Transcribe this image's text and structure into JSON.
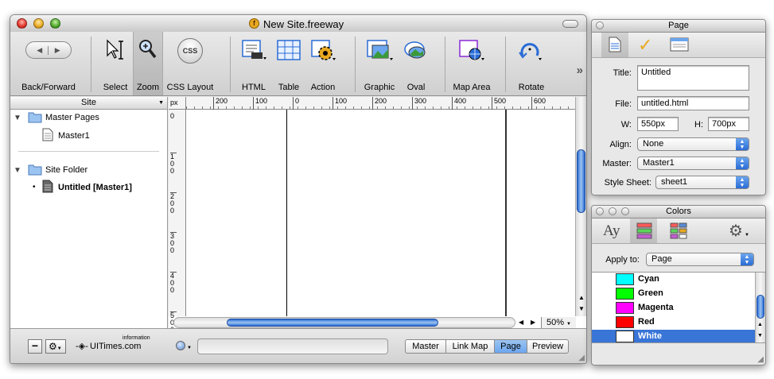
{
  "main_window": {
    "title": "New Site.freeway",
    "toolbar": [
      {
        "label": "Back/Forward"
      },
      {
        "label": "Select"
      },
      {
        "label": "Zoom"
      },
      {
        "label": "CSS Layout"
      },
      {
        "label": "HTML"
      },
      {
        "label": "Table"
      },
      {
        "label": "Action"
      },
      {
        "label": "Graphic"
      },
      {
        "label": "Oval"
      },
      {
        "label": "Map Area"
      },
      {
        "label": "Rotate"
      }
    ],
    "css_icon_text": "CSS",
    "overflow_glyph": "»",
    "site_panel": {
      "header": "Site",
      "tree": [
        {
          "label": "Master Pages",
          "type": "folder"
        },
        {
          "label": "Master1",
          "type": "page"
        },
        {
          "label": "Site Folder",
          "type": "folder"
        },
        {
          "label": "Untitled [Master1]",
          "type": "page",
          "current": true
        }
      ]
    },
    "ruler": {
      "unit": "px",
      "h_ticks": [
        "200",
        "100",
        "0",
        "100",
        "200",
        "300",
        "400",
        "500",
        "600"
      ],
      "v_ticks": [
        "0",
        "100",
        "200",
        "300",
        "400",
        "500"
      ]
    },
    "zoom_level": "50%",
    "status_bar": {
      "brand": "UITimes.com",
      "brand_sup": "information",
      "view_tabs": [
        "Master",
        "Link Map",
        "Page",
        "Preview"
      ],
      "active_tab": "Page"
    }
  },
  "page_palette": {
    "title": "Page",
    "fields": {
      "title_label": "Title:",
      "title_value": "Untitled",
      "file_label": "File:",
      "file_value": "untitled.html",
      "w_label": "W:",
      "w_value": "550px",
      "h_label": "H:",
      "h_value": "700px",
      "align_label": "Align:",
      "align_value": "None",
      "master_label": "Master:",
      "master_value": "Master1",
      "stylesheet_label": "Style Sheet:",
      "stylesheet_value": "sheet1"
    }
  },
  "colors_palette": {
    "title": "Colors",
    "text_tab_glyph": "Ay",
    "apply_label": "Apply to:",
    "apply_value": "Page",
    "colors": [
      {
        "name": "Cyan",
        "hex": "#00ffff"
      },
      {
        "name": "Green",
        "hex": "#00ff00"
      },
      {
        "name": "Magenta",
        "hex": "#ff00ff"
      },
      {
        "name": "Red",
        "hex": "#ff0000"
      },
      {
        "name": "White",
        "hex": "#ffffff",
        "selected": true
      }
    ]
  },
  "colors_meta": {
    "selection": "#3875d7",
    "aqua_blue": "#2a6cd6"
  }
}
